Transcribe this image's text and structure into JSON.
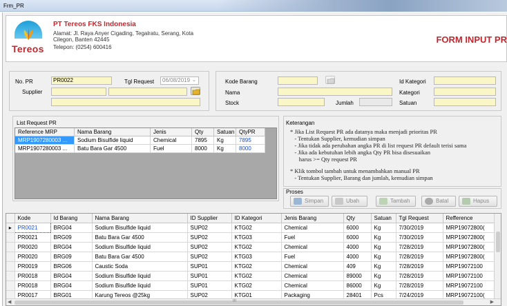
{
  "window": {
    "title": "Frm_PR"
  },
  "company": {
    "logo_text": "Tereos",
    "name": "PT Tereos FKS Indonesia",
    "address_line1": "Alamat: Jl. Raya Anyer Cigading, Tegalratu, Serang, Kota",
    "address_line2": "Cilegon, Banten 42445",
    "phone": "Telepon: (0254) 600416"
  },
  "form_title": "FORM INPUT PR",
  "pr": {
    "no_pr_label": "No. PR",
    "no_pr_value": "PR0022",
    "tgl_label": "Tgl Request",
    "tgl_value": "06/08/2019",
    "supplier_label": "Supplier"
  },
  "barang": {
    "kode_label": "Kode Barang",
    "nama_label": "Nama",
    "stock_label": "Stock",
    "jumlah_label": "Jumlah",
    "idkat_label": "Id Kategori",
    "kat_label": "Kategori",
    "satuan_label": "Satuan"
  },
  "list_request": {
    "title": "List Request PR",
    "columns": [
      "Reference MRP",
      "Nama Barang",
      "Jenis",
      "Qty",
      "Satuan",
      "QtyPR"
    ],
    "rows": [
      [
        "MRP1907280003 ...",
        "Sodium Bisulfide liquid",
        "Chemical",
        "7895",
        "Kg",
        "7895"
      ],
      [
        "MRP1907280003 ...",
        "Batu Bara Gar 4500",
        "Fuel",
        "8000",
        "Kg",
        "8000"
      ]
    ]
  },
  "keterangan": {
    "title": "Keterangan",
    "lines": [
      "* Jika List Request PR ada datanya maka menjadi prioritas PR",
      "   - Tentukan Supplier, kemudian simpan",
      "   - Jika tidak ada perubahan angka PR di list request PR default terisi sama",
      "   - Jika ada kebutuhan lebih angka Qty PR bisa disesuaikan",
      "      harus >= Qty request PR",
      "",
      "* Klik tombol tambah untuk menambahkan manual PR",
      "   - Tentukan Supplier, Barang dan jumlah, kemudian simpan"
    ]
  },
  "proses": {
    "title": "Proses",
    "simpan": "Simpan",
    "ubah": "Ubah",
    "tambah": "Tambah",
    "batal": "Batal",
    "hapus": "Hapus"
  },
  "pr_table": {
    "columns": [
      "Kode",
      "Id Barang",
      "Nama Barang",
      "ID Supplier",
      "ID Kategori",
      "Jenis Barang",
      "Qty",
      "Satuan",
      "Tgl Request",
      "Refference"
    ],
    "rows": [
      [
        "PR0021",
        "BRG04",
        "Sodium Bisulfide liquid",
        "SUP02",
        "KTG02",
        "Chemical",
        "6000",
        "Kg",
        "7/30/2019",
        "MRP19072800("
      ],
      [
        "PR0021",
        "BRG09",
        "Batu Bara Gar 4500",
        "SUP02",
        "KTG03",
        "Fuel",
        "6000",
        "Kg",
        "7/30/2019",
        "MRP19072800("
      ],
      [
        "PR0020",
        "BRG04",
        "Sodium Bisulfide liquid",
        "SUP02",
        "KTG02",
        "Chemical",
        "4000",
        "Kg",
        "7/28/2019",
        "MRP19072800("
      ],
      [
        "PR0020",
        "BRG09",
        "Batu Bara Gar 4500",
        "SUP02",
        "KTG03",
        "Fuel",
        "4000",
        "Kg",
        "7/28/2019",
        "MRP19072800("
      ],
      [
        "PR0019",
        "BRG06",
        "Caustic Soda",
        "SUP01",
        "KTG02",
        "Chemical",
        "409",
        "Kg",
        "7/28/2019",
        "MRP19072100"
      ],
      [
        "PR0018",
        "BRG04",
        "Sodium Bisulfide liquid",
        "SUP01",
        "KTG02",
        "Chemical",
        "89000",
        "Kg",
        "7/28/2019",
        "MRP19072100"
      ],
      [
        "PR0018",
        "BRG04",
        "Sodium Bisulfide liquid",
        "SUP01",
        "KTG02",
        "Chemical",
        "86000",
        "Kg",
        "7/28/2019",
        "MRP19072100"
      ],
      [
        "PR0017",
        "BRG01",
        "Karung Tereos @25kg",
        "SUP02",
        "KTG01",
        "Packaging",
        "28401",
        "Pcs",
        "7/24/2019",
        "MRP19072100("
      ]
    ],
    "hscroll_mark": "III"
  }
}
